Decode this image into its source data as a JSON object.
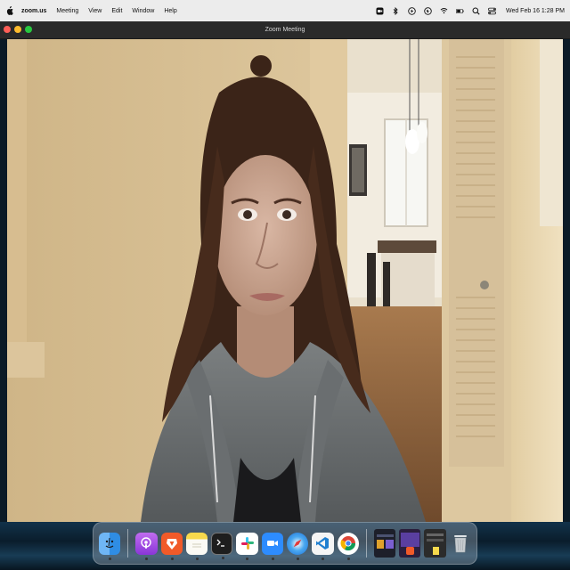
{
  "menubar": {
    "app_name": "zoom.us",
    "menus": [
      "Meeting",
      "View",
      "Edit",
      "Window",
      "Help"
    ],
    "status_icons": [
      "zoom-icon",
      "bluetooth-icon",
      "play-circle-icon",
      "cursor-icon",
      "wifi-icon",
      "battery-icon",
      "search-icon",
      "control-center-icon"
    ],
    "clock": "Wed Feb 16  1:28 PM"
  },
  "window": {
    "title": "Zoom Meeting"
  },
  "dock": {
    "apps": [
      "finder-icon",
      "podcasts-icon",
      "brave-browser-icon",
      "notes-icon",
      "terminal-icon",
      "slack-icon",
      "zoom-icon",
      "safari-icon",
      "vscode-icon",
      "chrome-icon"
    ],
    "recents": [
      "window-thumbnail",
      "window-thumbnail",
      "window-thumbnail"
    ],
    "trash": "trash-icon",
    "colors": {
      "finder": "#2f8de4",
      "podcasts": "#9b4de0",
      "brave": "#f15a29",
      "notes": "#f7d94c",
      "terminal": "#1e1e1e",
      "slack": "#ffffff",
      "zoom": "#2d8cff",
      "safari": "#1d8fe0",
      "vscode": "#1f7fd0",
      "chrome": "#ffffff"
    }
  }
}
